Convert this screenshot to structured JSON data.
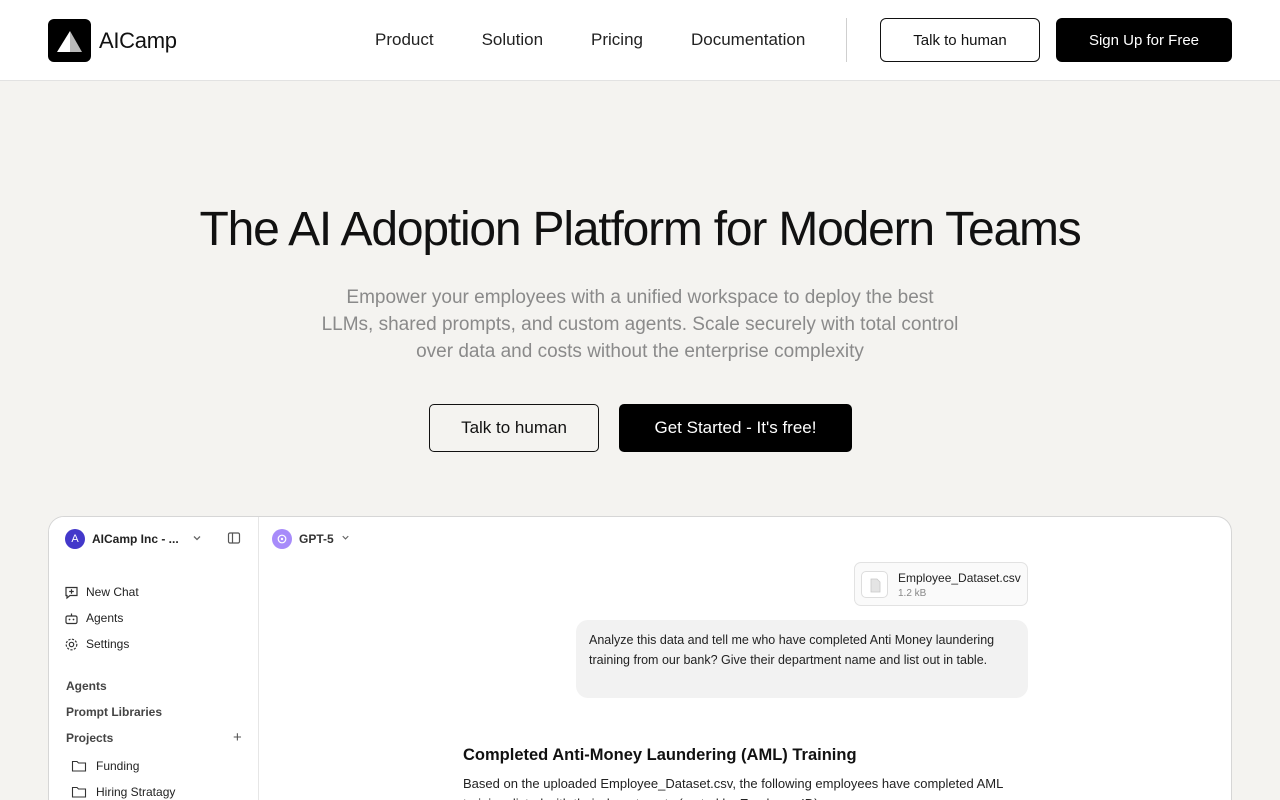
{
  "header": {
    "brand": "AICamp",
    "nav": [
      "Product",
      "Solution",
      "Pricing",
      "Documentation"
    ],
    "talk_label": "Talk to human",
    "signup_label": "Sign Up for Free"
  },
  "hero": {
    "title": "The AI Adoption Platform for Modern Teams",
    "subtitle": "Empower your employees with a unified workspace to deploy the best LLMs, shared prompts, and custom agents. Scale securely with total control over data and costs without the enterprise complexity",
    "talk_label": "Talk to human",
    "start_label": "Get Started - It's free!"
  },
  "preview": {
    "workspace_initial": "A",
    "workspace_name": "AICamp Inc - ...",
    "sidebar": {
      "new_chat": "New Chat",
      "agents": "Agents",
      "settings": "Settings",
      "section_agents": "Agents",
      "section_prompts": "Prompt Libraries",
      "section_projects": "Projects",
      "projects": [
        "Funding",
        "Hiring Stratagy"
      ]
    },
    "model": "GPT-5",
    "file": {
      "name": "Employee_Dataset.csv",
      "size": "1.2 kB"
    },
    "user_message": "Analyze this data and tell me who have completed Anti Money laundering training from our bank? Give their department name and list out in table.",
    "response_title": "Completed Anti-Money Laundering (AML) Training",
    "response_body": "Based on the uploaded Employee_Dataset.csv, the following employees have completed AML training, listed with their departments (sorted by Employee ID)."
  },
  "colors": {
    "accent": "#000000",
    "background": "#f4f3f0",
    "workspace_avatar": "#4338ca",
    "model_icon": "#a78bfa"
  }
}
